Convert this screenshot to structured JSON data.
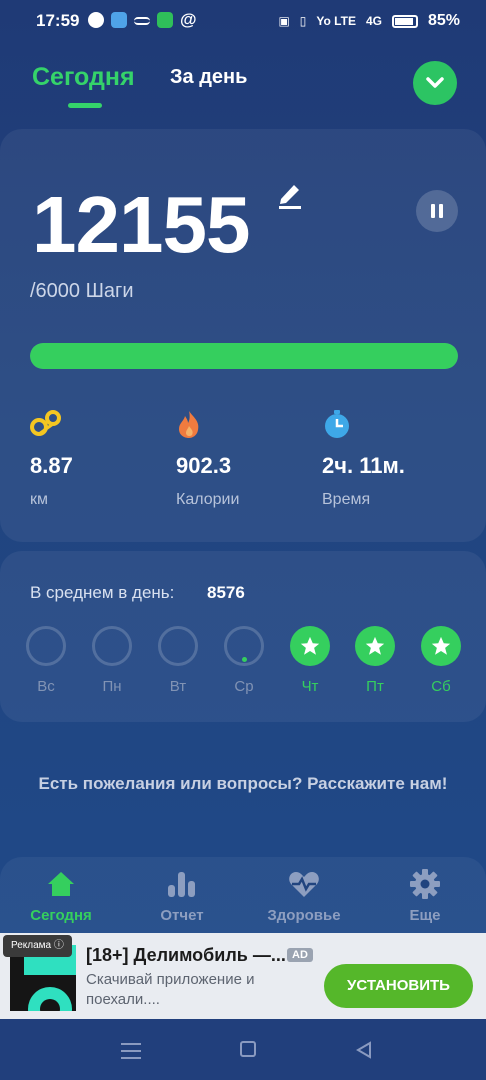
{
  "status_bar": {
    "time": "17:59",
    "icons_left": [
      "chat-icon",
      "app-icon",
      "lines-icon",
      "app-green-icon",
      "at-icon"
    ],
    "icons_right": [
      "nfc-icon",
      "vibrate-icon",
      "volte-icon",
      "signal-4g-icon",
      "battery-icon"
    ],
    "volte_text": "Yo LTE",
    "network_text": "4G",
    "battery": "85%"
  },
  "tabs": {
    "today": "Сегодня",
    "day": "За день"
  },
  "main": {
    "steps": "12155",
    "goal_text": "/6000 Шаги",
    "progress": 1.0,
    "stats": [
      {
        "icon": "distance-icon",
        "value": "8.87",
        "label": "км"
      },
      {
        "icon": "flame-icon",
        "value": "902.3",
        "label": "Калории"
      },
      {
        "icon": "clock-icon",
        "value": "2ч. 11м.",
        "label": "Время"
      }
    ]
  },
  "average": {
    "label": "В среднем в день:",
    "value": "8576",
    "days": [
      {
        "label": "Вс",
        "done": false,
        "partial": false
      },
      {
        "label": "Пн",
        "done": false,
        "partial": false
      },
      {
        "label": "Вт",
        "done": false,
        "partial": false
      },
      {
        "label": "Ср",
        "done": false,
        "partial": true
      },
      {
        "label": "Чт",
        "done": true,
        "partial": false
      },
      {
        "label": "Пт",
        "done": true,
        "partial": false
      },
      {
        "label": "Сб",
        "done": true,
        "partial": false
      }
    ]
  },
  "feedback": "Есть пожелания или вопросы? Расскажите нам!",
  "bottom_nav": [
    {
      "label": "Сегодня",
      "icon": "home-icon",
      "active": true
    },
    {
      "label": "Отчет",
      "icon": "bar-chart-icon",
      "active": false
    },
    {
      "label": "Здоровье",
      "icon": "heart-pulse-icon",
      "active": false
    },
    {
      "label": "Еще",
      "icon": "gear-icon",
      "active": false
    }
  ],
  "ad": {
    "tag": "Реклама",
    "title": "[18+] Делимобиль —...",
    "badge": "AD",
    "description": "Скачивай приложение и поехали....",
    "install": "УСТАНОВИТЬ"
  },
  "colors": {
    "accent": "#35cf5e",
    "background": "#21447f",
    "distance": "#f4c621",
    "flame": "#f07b3f",
    "clock": "#3ea8e8"
  }
}
